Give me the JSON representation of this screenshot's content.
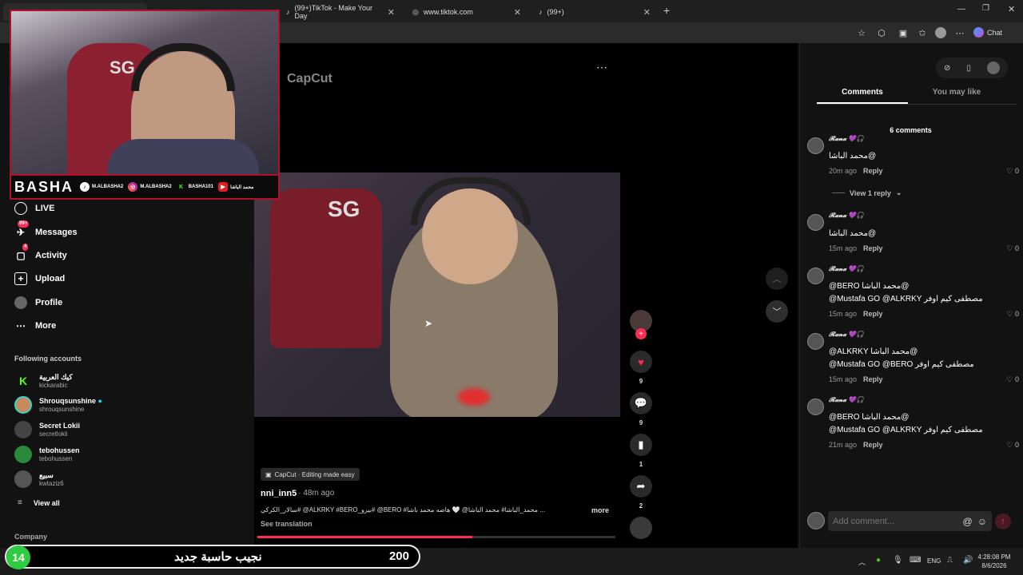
{
  "browser": {
    "tabs": [
      {
        "label": "(99+)TikTok - Make Your Day"
      },
      {
        "label": "www.tiktok.com"
      },
      {
        "label": "(99+)"
      }
    ],
    "chat_label": "Chat"
  },
  "sidebar": {
    "nav": [
      {
        "label": "LIVE",
        "icon": "live-icon"
      },
      {
        "label": "Messages",
        "icon": "messages-icon",
        "badge": "99+"
      },
      {
        "label": "Activity",
        "icon": "activity-icon",
        "badge": "4"
      },
      {
        "label": "Upload",
        "icon": "upload-icon"
      },
      {
        "label": "Profile",
        "icon": "profile-icon"
      },
      {
        "label": "More",
        "icon": "more-icon"
      }
    ],
    "following_title": "Following accounts",
    "accounts": [
      {
        "name": "كيك العربية",
        "username": "kickarabic",
        "color": "#53fc18"
      },
      {
        "name": "Shrouqsunshine",
        "username": "shrouqsunshine",
        "color": "#c88a5a"
      },
      {
        "name": "Secret Lokii",
        "username": "secretlokii",
        "color": "#444"
      },
      {
        "name": "tebohussen",
        "username": "tebohussen",
        "color": "#2a8a3a"
      },
      {
        "name": "سبيع",
        "username": "kwtaziz6",
        "color": "#555"
      }
    ],
    "view_all": "View all",
    "company": "Company"
  },
  "overlay": {
    "brand": "BASHA",
    "handles": [
      "M.ALBASHA2",
      "M.ALBASHA2",
      "BASHA101",
      "محمد الباشا"
    ],
    "logo_text": "SG"
  },
  "video": {
    "watermark": "CapCut",
    "logo_text": "SG",
    "capcut_tag": "CapCut · Editing made easy",
    "author": "nni_inn5",
    "time": " · 48m ago",
    "caption": "سالار_الكركي# @ALKRKY #BERO_بيرو# @BERO #محمد_الباشا# محمد الباشا@ 🤍 هاضه محمد باشا ...",
    "more": "more",
    "see_translation": "See translation",
    "progress": 0.6,
    "likes": "9",
    "comments": "9",
    "saves": "1",
    "shares": "2"
  },
  "comments_panel": {
    "tab_comments": "Comments",
    "tab_like": "You may like",
    "count": "6 comments",
    "comments": [
      {
        "user": "𝓡𝓪𝓷𝓪 💜🎧",
        "lines": [
          "محمد الباشا@"
        ],
        "time": "20m ago",
        "reply": "Reply",
        "likes": "0"
      },
      {
        "user": "𝓡𝓪𝓷𝓪 💜🎧",
        "lines": [
          "محمد الباشا@"
        ],
        "time": "15m ago",
        "reply": "Reply",
        "likes": "0"
      },
      {
        "user": "𝓡𝓪𝓷𝓪 💜🎧",
        "lines": [
          "@BERO محمد الباشا@",
          "@Mustafa GO @ALKRKY مصطفى كيم اوفر"
        ],
        "time": "15m ago",
        "reply": "Reply",
        "likes": "0"
      },
      {
        "user": "𝓡𝓪𝓷𝓪 💜🎧",
        "lines": [
          "@ALKRKY محمد الباشا@",
          "@Mustafa GO @BERO مصطفى كيم اوفر"
        ],
        "time": "15m ago",
        "reply": "Reply",
        "likes": "0"
      },
      {
        "user": "𝓡𝓪𝓷𝓪 💜🎧",
        "lines": [
          "@BERO محمد الباشا@",
          "@Mustafa GO @ALKRKY مصطفى كيم اوفر"
        ],
        "time": "21m ago",
        "reply": "Reply",
        "likes": "0"
      }
    ],
    "view_reply": "View 1 reply",
    "add_placeholder": "Add comment..."
  },
  "stream_overlay": {
    "level": "14",
    "text": "نجيب حاسبة جديد",
    "count": "200"
  },
  "taskbar": {
    "lang": "ENG",
    "time": "4:28:08 PM",
    "date": "8/6/2026"
  },
  "colors": {
    "accent": "#fe2c55",
    "overlay_red": "#b0102a",
    "level_green": "#2ecc40"
  }
}
